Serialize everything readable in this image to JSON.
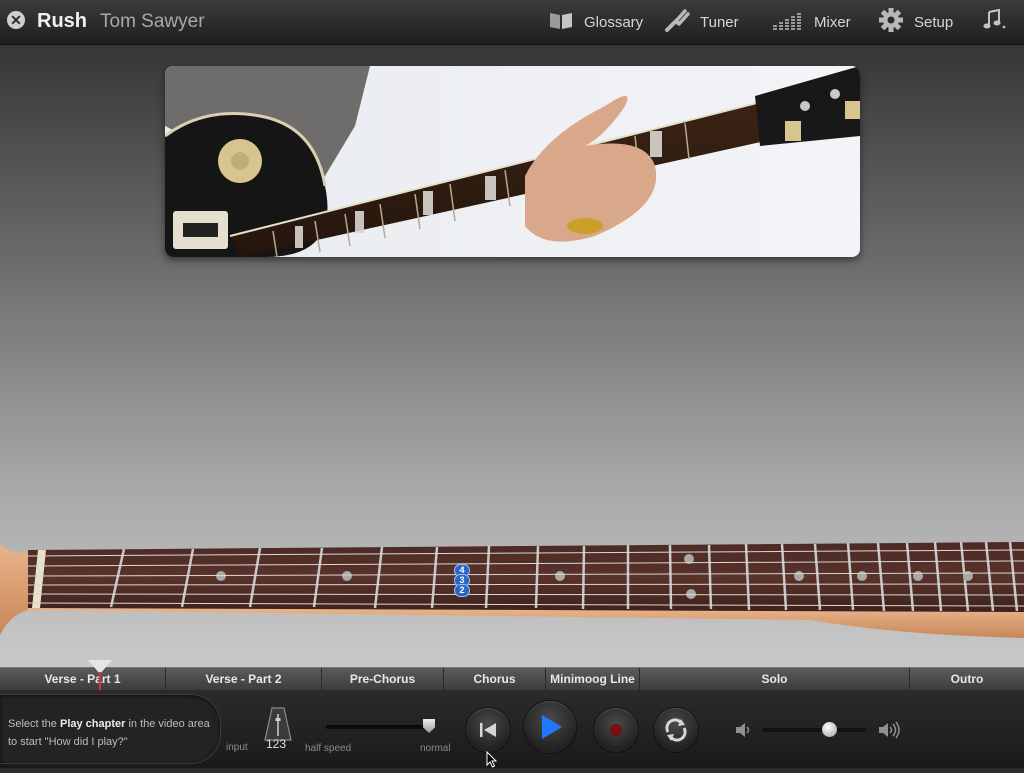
{
  "header": {
    "artist": "Rush",
    "song": "Tom Sawyer",
    "nav": [
      {
        "label": "Glossary",
        "icon": "book-icon"
      },
      {
        "label": "Tuner",
        "icon": "tuning-fork-icon"
      },
      {
        "label": "Mixer",
        "icon": "mixer-bars-icon"
      },
      {
        "label": "Setup",
        "icon": "gear-icon"
      },
      {
        "label": "",
        "icon": "music-note-icon"
      }
    ]
  },
  "fretboard": {
    "finger_marks": [
      "4",
      "3",
      "2"
    ]
  },
  "chapters": [
    {
      "label": "Verse - Part 1"
    },
    {
      "label": "Verse - Part 2"
    },
    {
      "label": "Pre-Chorus"
    },
    {
      "label": "Chorus"
    },
    {
      "label": "Minimoog Line"
    },
    {
      "label": "Solo"
    },
    {
      "label": "Outro"
    }
  ],
  "controls": {
    "hint_prefix": "Select the ",
    "hint_bold": "Play chapter",
    "hint_suffix": " in the video area to start \"How did I play?\"",
    "input_label": "input",
    "metronome_value": "123",
    "half_speed_label": "half speed",
    "normal_label": "normal",
    "speed_value": 1.0,
    "volume_value": 0.66
  },
  "colors": {
    "play_accent": "#1f78ff",
    "record": "#7a1010",
    "finger_marker": "#2a66c8"
  }
}
